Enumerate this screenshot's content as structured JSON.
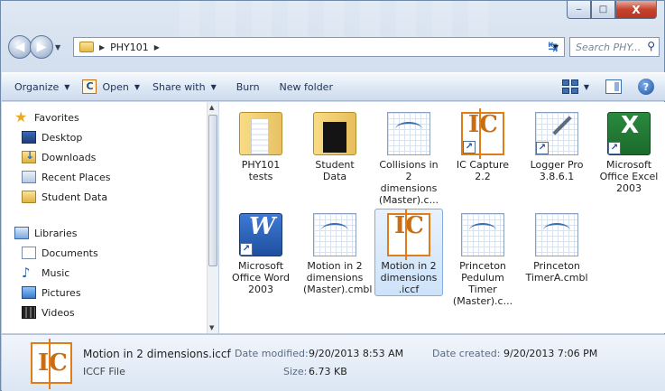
{
  "window": {
    "caption": {
      "minimize": "‒",
      "maximize": "□",
      "close": "X"
    }
  },
  "address_bar": {
    "crumb": "PHY101",
    "search_placeholder": "Search PHY..."
  },
  "toolbar": {
    "organize": "Organize",
    "open": "Open",
    "share_with": "Share with",
    "burn": "Burn",
    "new_folder": "New folder"
  },
  "navpane": {
    "favorites": "Favorites",
    "desktop": "Desktop",
    "downloads": "Downloads",
    "recent_places": "Recent Places",
    "student_data": "Student Data",
    "libraries": "Libraries",
    "documents": "Documents",
    "music": "Music",
    "pictures": "Pictures",
    "videos": "Videos"
  },
  "files": [
    {
      "label": "PHY101 tests",
      "icon": "folder-icon"
    },
    {
      "label": "Student Data",
      "icon": "folder-icon"
    },
    {
      "label": "Collisions in 2 dimensions (Master).c...",
      "icon": "graph-document-icon"
    },
    {
      "label": "IC Capture 2.2",
      "icon": "ic-capture-icon"
    },
    {
      "label": "Logger Pro 3.8.6.1",
      "icon": "logger-pro-icon"
    },
    {
      "label": "Microsoft Office Excel 2003",
      "icon": "excel-icon"
    },
    {
      "label": "Microsoft Office Word 2003",
      "icon": "word-icon"
    },
    {
      "label": "Motion in 2 dimensions (Master).cmbl",
      "icon": "graph-document-icon"
    },
    {
      "label": "Motion in 2 dimensions .iccf",
      "icon": "ic-capture-icon"
    },
    {
      "label": "Princeton Pedulum Timer (Master).c...",
      "icon": "graph-document-icon"
    },
    {
      "label": "Princeton TimerA.cmbl",
      "icon": "graph-document-icon"
    }
  ],
  "details": {
    "file_name": "Motion in 2 dimensions.iccf",
    "file_type": "ICCF File",
    "date_modified_label": "Date modified:",
    "date_modified": "9/20/2013 8:53 AM",
    "size_label": "Size:",
    "size": "6.73 KB",
    "date_created_label": "Date created:",
    "date_created": "9/20/2013 7:06 PM"
  },
  "colors": {
    "accent": "#3b6fb1",
    "selection": "#cde2fa",
    "ic_orange": "#e07d16"
  }
}
